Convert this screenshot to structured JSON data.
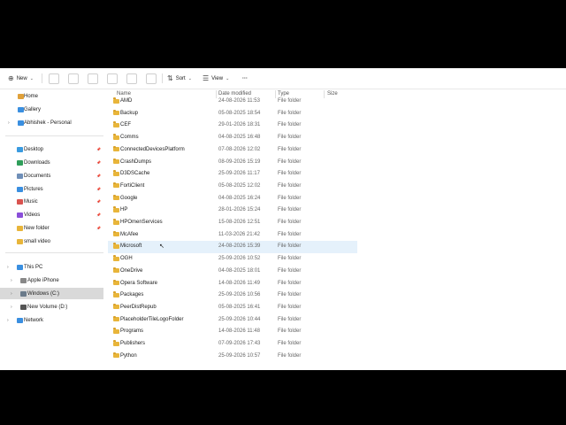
{
  "toolbar": {
    "new_label": "New",
    "sort_label": "Sort",
    "view_label": "View",
    "more_label": "···"
  },
  "nav": {
    "items": [
      {
        "label": "Home",
        "icon": "home-icon",
        "color": "#e0a13a"
      },
      {
        "label": "Gallery",
        "icon": "gallery-icon",
        "color": "#3a8fe0"
      },
      {
        "label": "Abhishek - Personal",
        "icon": "onedrive-icon",
        "color": "#3a8fe0"
      },
      {
        "label": "Desktop",
        "icon": "desktop-icon",
        "color": "#3a9be0",
        "pinned": true
      },
      {
        "label": "Downloads",
        "icon": "downloads-icon",
        "color": "#2f9e5a",
        "pinned": true
      },
      {
        "label": "Documents",
        "icon": "documents-icon",
        "color": "#6f8fb8",
        "pinned": true
      },
      {
        "label": "Pictures",
        "icon": "pictures-icon",
        "color": "#3a8fe0",
        "pinned": true
      },
      {
        "label": "Music",
        "icon": "music-icon",
        "color": "#d9534f",
        "pinned": true
      },
      {
        "label": "Videos",
        "icon": "videos-icon",
        "color": "#8a4fd9",
        "pinned": true
      },
      {
        "label": "New folder",
        "icon": "folder-icon",
        "color": "#e8b53a",
        "pinned": true
      },
      {
        "label": "small video",
        "icon": "folder-icon",
        "color": "#e8b53a"
      },
      {
        "label": "This PC",
        "icon": "this-pc-icon",
        "color": "#3a8fe0"
      },
      {
        "label": "Apple iPhone",
        "icon": "phone-icon",
        "color": "#888888"
      },
      {
        "label": "Windows (C:)",
        "icon": "drive-icon",
        "color": "#6a7a8a"
      },
      {
        "label": "New Volume (D:)",
        "icon": "drive-icon",
        "color": "#555555"
      },
      {
        "label": "Network",
        "icon": "network-icon",
        "color": "#3a8fe0"
      }
    ]
  },
  "list": {
    "headers": {
      "name": "Name",
      "date": "Date modified",
      "type": "Type",
      "size": "Size"
    },
    "rows": [
      {
        "name": "AMD",
        "date": "24-08-2026 11:53",
        "type": "File folder"
      },
      {
        "name": "Backup",
        "date": "05-08-2025 18:54",
        "type": "File folder"
      },
      {
        "name": "CEF",
        "date": "29-01-2026 18:31",
        "type": "File folder"
      },
      {
        "name": "Comms",
        "date": "04-08-2025 16:48",
        "type": "File folder"
      },
      {
        "name": "ConnectedDevicesPlatform",
        "date": "07-08-2026 12:02",
        "type": "File folder"
      },
      {
        "name": "CrashDumps",
        "date": "08-09-2026 15:19",
        "type": "File folder"
      },
      {
        "name": "D3DSCache",
        "date": "25-09-2026 11:17",
        "type": "File folder"
      },
      {
        "name": "FortiClient",
        "date": "05-08-2025 12:02",
        "type": "File folder"
      },
      {
        "name": "Google",
        "date": "04-08-2025 16:24",
        "type": "File folder"
      },
      {
        "name": "HP",
        "date": "28-01-2026 15:24",
        "type": "File folder"
      },
      {
        "name": "HPOmenServices",
        "date": "15-08-2026 12:51",
        "type": "File folder"
      },
      {
        "name": "McAfee",
        "date": "11-03-2026 21:42",
        "type": "File folder"
      },
      {
        "name": "Microsoft",
        "date": "24-08-2026 15:39",
        "type": "File folder"
      },
      {
        "name": "OGH",
        "date": "25-09-2026 10:52",
        "type": "File folder"
      },
      {
        "name": "OneDrive",
        "date": "04-08-2025 18:01",
        "type": "File folder"
      },
      {
        "name": "Opera Software",
        "date": "14-08-2026 11:49",
        "type": "File folder"
      },
      {
        "name": "Packages",
        "date": "25-09-2026 10:56",
        "type": "File folder"
      },
      {
        "name": "PeerDistRepub",
        "date": "05-08-2025 16:41",
        "type": "File folder"
      },
      {
        "name": "PlaceholderTileLogoFolder",
        "date": "25-09-2026 10:44",
        "type": "File folder"
      },
      {
        "name": "Programs",
        "date": "14-08-2026 11:48",
        "type": "File folder"
      },
      {
        "name": "Publishers",
        "date": "07-09-2026 17:43",
        "type": "File folder"
      },
      {
        "name": "Python",
        "date": "25-09-2026 10:57",
        "type": "File folder"
      }
    ]
  }
}
